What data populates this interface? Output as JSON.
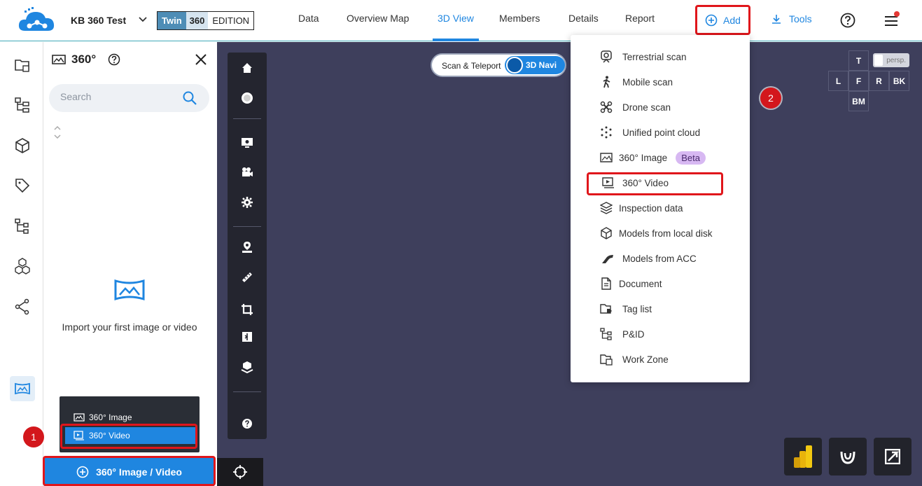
{
  "header": {
    "project_name": "KB 360 Test",
    "edition": {
      "twin": "Twin",
      "n360": "360",
      "label": "EDITION"
    },
    "nav": [
      "Data",
      "Overview Map",
      "3D View",
      "Members",
      "Details",
      "Report"
    ],
    "active_nav": "3D View",
    "add_label": "Add",
    "tools_label": "Tools"
  },
  "panel": {
    "title": "360°",
    "search_placeholder": "Search",
    "empty_text": "Import your first image or video",
    "popup": {
      "image": "360° Image",
      "video": "360° Video"
    },
    "main_button": "360° Image / Video"
  },
  "viewport": {
    "nav_toggle": {
      "scan": "Scan & Teleport",
      "navi": "3D Navi"
    },
    "view_cube": {
      "top": "T",
      "left": "L",
      "front": "F",
      "right": "R",
      "back": "BK",
      "bottom": "BM"
    },
    "persp_label": "persp."
  },
  "add_menu": {
    "items": [
      {
        "label": "Terrestrial scan",
        "icon": "terrestrial-scanner-icon"
      },
      {
        "label": "Mobile scan",
        "icon": "walking-person-icon"
      },
      {
        "label": "Drone scan",
        "icon": "drone-icon"
      },
      {
        "label": "Unified point cloud",
        "icon": "point-cloud-icon"
      },
      {
        "label": "360° Image",
        "icon": "panorama-image-icon",
        "badge": "Beta"
      },
      {
        "label": "360° Video",
        "icon": "panorama-video-icon"
      },
      {
        "label": "Inspection data",
        "icon": "layers-icon"
      },
      {
        "label": "Models from local disk",
        "icon": "cube-icon"
      },
      {
        "label": "Models from ACC",
        "icon": "acc-logo-icon"
      },
      {
        "label": "Document",
        "icon": "document-icon"
      },
      {
        "label": "Tag list",
        "icon": "tag-folder-icon"
      },
      {
        "label": "P&ID",
        "icon": "pid-tree-icon"
      },
      {
        "label": "Work Zone",
        "icon": "work-zone-icon"
      }
    ]
  },
  "steps": {
    "one": "1",
    "two": "2"
  },
  "colors": {
    "accent": "#1f86e0",
    "highlight": "#e0161b",
    "viewport_bg": "#3e3f5c"
  }
}
